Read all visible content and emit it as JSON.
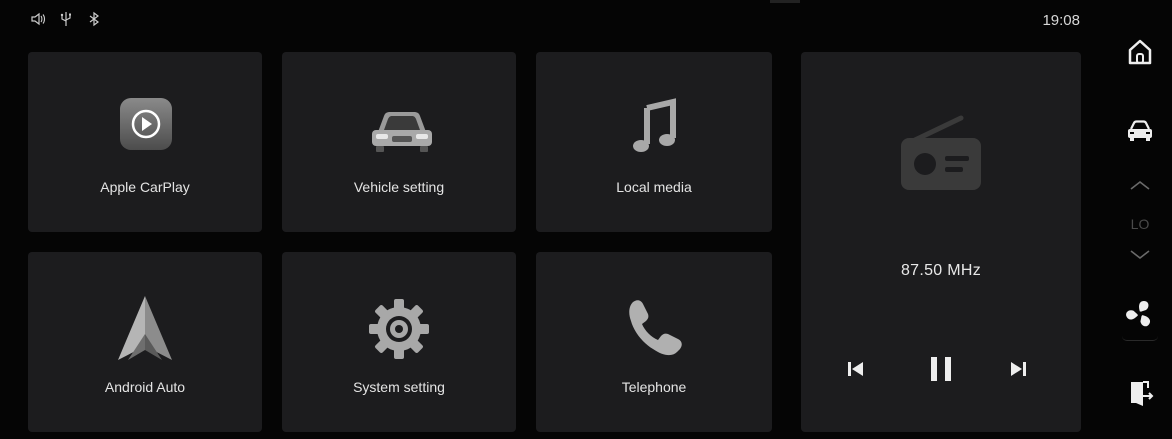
{
  "status_bar": {
    "time": "19:08",
    "icons": [
      "volume-icon",
      "usb-icon",
      "bluetooth-icon"
    ]
  },
  "tiles": [
    {
      "label": "Apple CarPlay",
      "icon": "carplay-icon"
    },
    {
      "label": "Vehicle setting",
      "icon": "car-front-icon"
    },
    {
      "label": "Local media",
      "icon": "music-note-icon"
    },
    {
      "label": "Android Auto",
      "icon": "android-auto-icon"
    },
    {
      "label": "System setting",
      "icon": "gear-icon"
    },
    {
      "label": "Telephone",
      "icon": "phone-icon"
    }
  ],
  "radio": {
    "frequency": "87.50 MHz",
    "icon": "radio-icon",
    "controls": [
      "previous-track-icon",
      "pause-icon",
      "next-track-icon"
    ]
  },
  "sidebar": {
    "temperature_label": "LO",
    "buttons": [
      "home-icon",
      "car-icon",
      "chevron-up-icon",
      "chevron-down-icon",
      "fan-icon",
      "exit-icon"
    ]
  },
  "colors": {
    "background": "#050505",
    "tile": "#1c1c1e",
    "text": "#e4e4e4",
    "muted": "#4a4a4a"
  }
}
